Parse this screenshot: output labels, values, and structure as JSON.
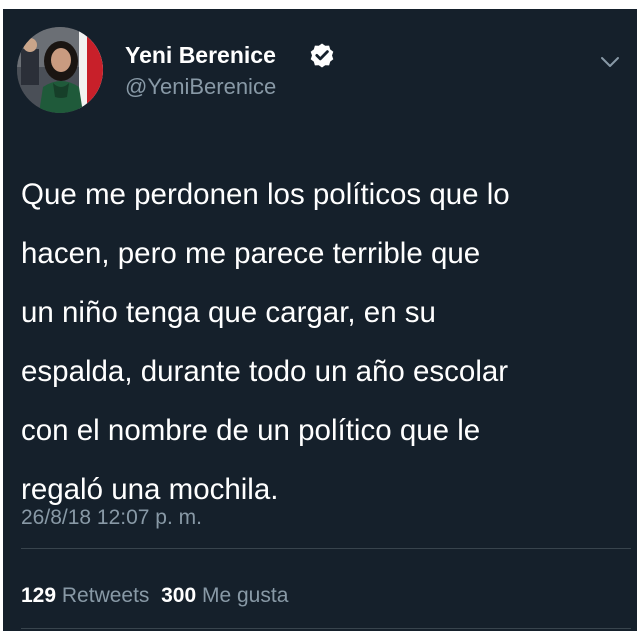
{
  "tweet": {
    "author_name": "Yeni Berenice",
    "handle": "@YeniBerenice",
    "verified": true,
    "text_lines": [
      "Que me perdonen los políticos que lo",
      "hacen, pero me parece terrible que",
      "un niño tenga que cargar, en su",
      "espalda, durante todo un año escolar",
      "con el nombre de un político que le",
      "regaló una mochila."
    ],
    "timestamp": "26/8/18 12:07 p. m."
  },
  "stats": {
    "retweets_count": "129",
    "retweets_label": "Retweets",
    "likes_count": "300",
    "likes_label": "Me gusta"
  },
  "icons": {
    "verified": "verified-badge-icon",
    "menu": "chevron-down-icon"
  },
  "colors": {
    "background": "#15202b",
    "primary_text": "#ffffff",
    "secondary_text": "#8899a6",
    "divider": "#38444d"
  }
}
